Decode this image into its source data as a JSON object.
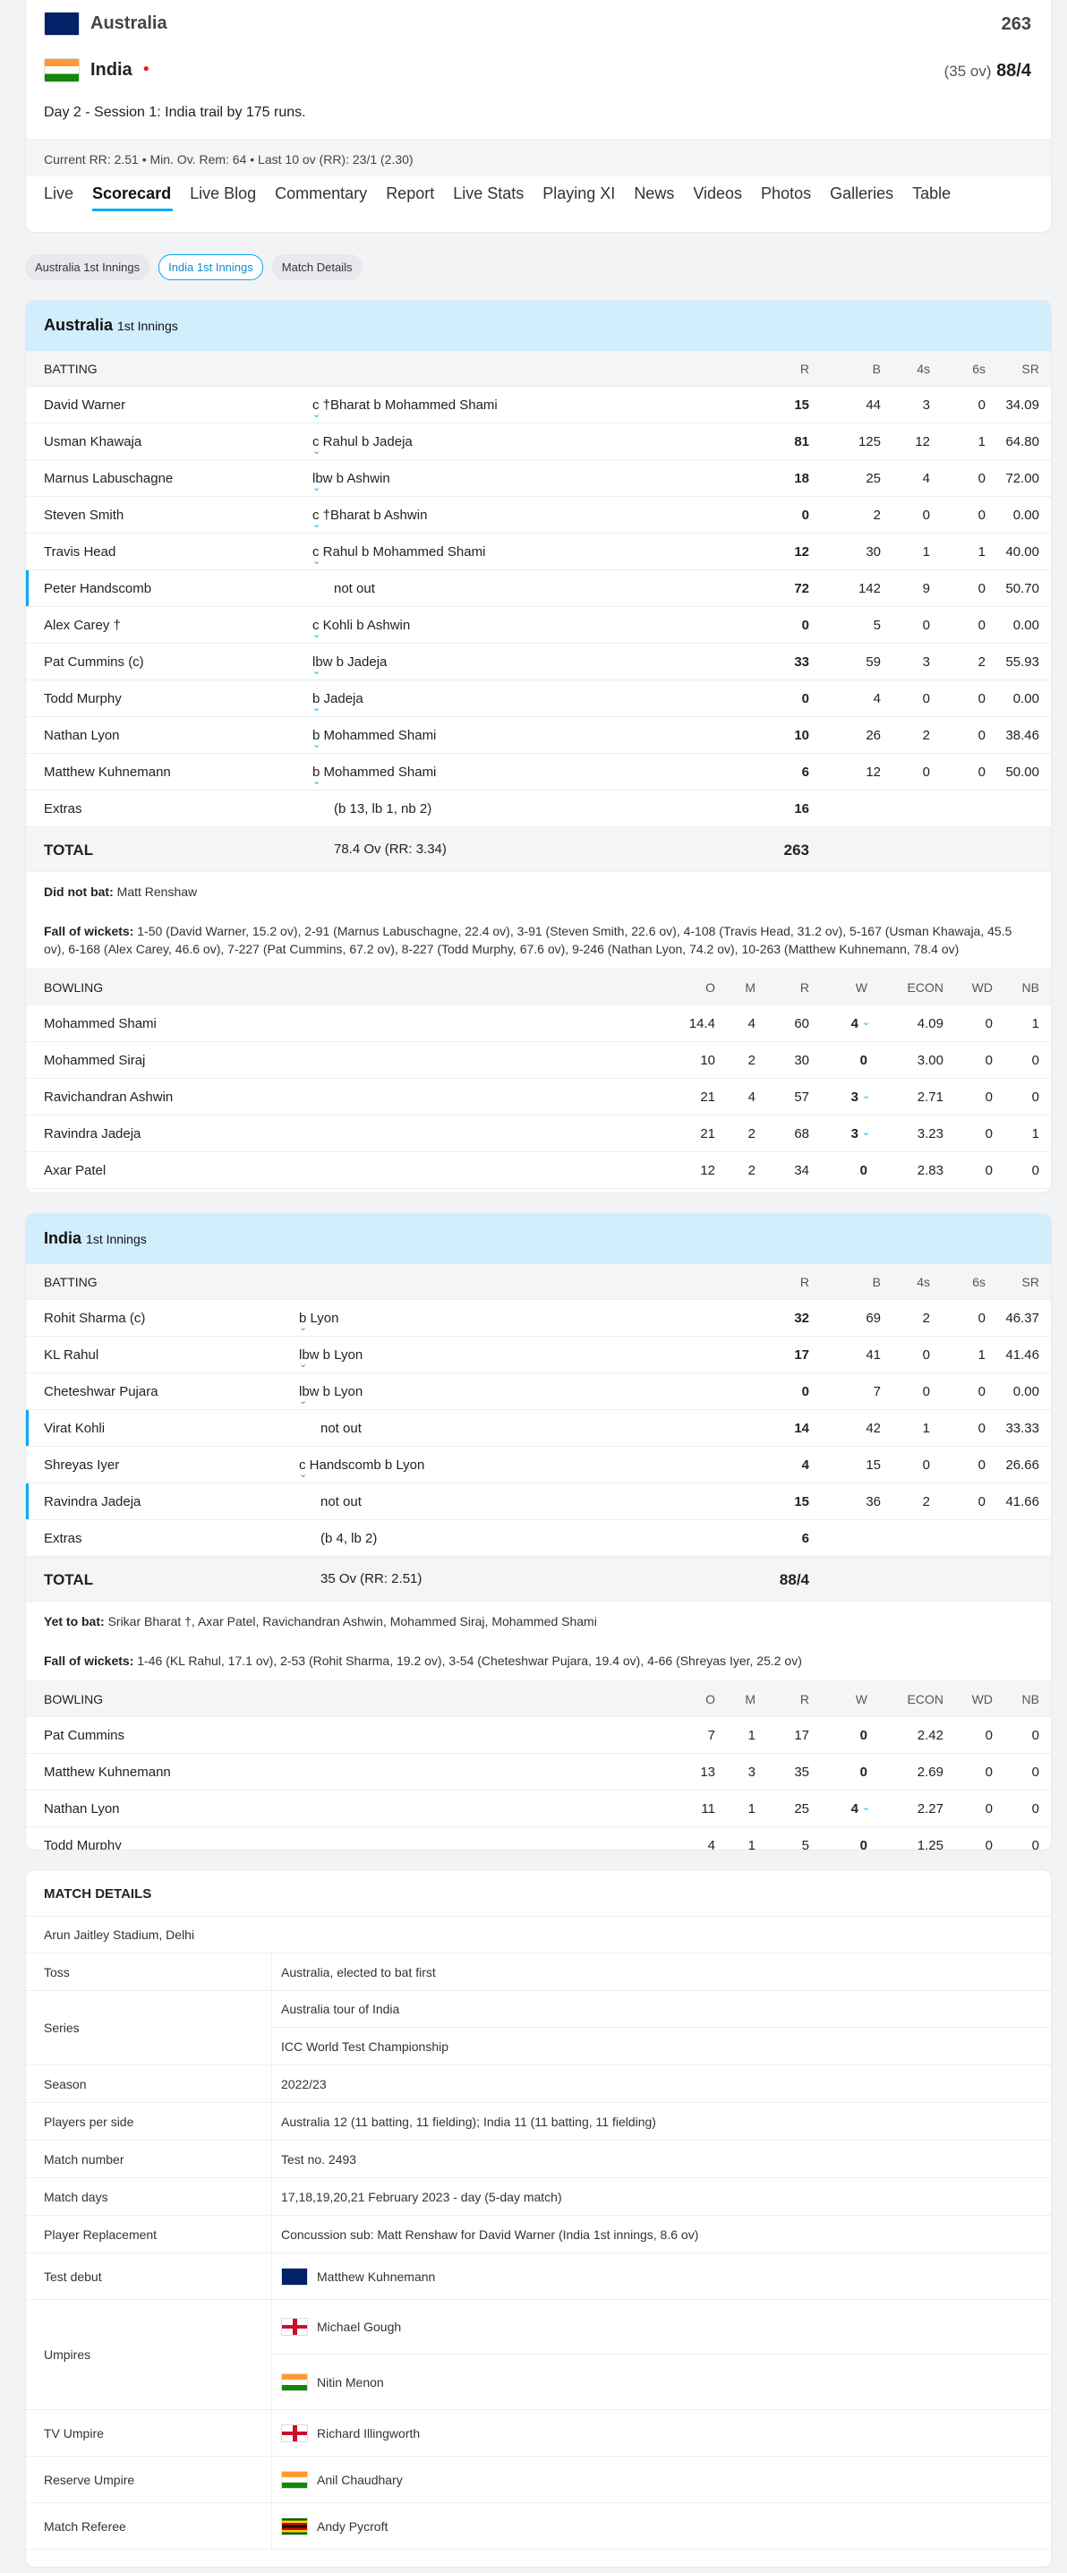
{
  "header": {
    "team1": {
      "name": "Australia",
      "score": "263"
    },
    "team2": {
      "name": "India",
      "overs": "(35 ov)",
      "score": "88/4"
    },
    "status": "Day 2 - Session 1: India trail by 175 runs.",
    "rates": "Current RR: 2.51 • Min. Ov. Rem: 64 • Last 10 ov (RR): 23/1 (2.30)",
    "tabs": [
      "Live",
      "Scorecard",
      "Live Blog",
      "Commentary",
      "Report",
      "Live Stats",
      "Playing XI",
      "News",
      "Videos",
      "Photos",
      "Galleries",
      "Table"
    ],
    "active_tab": "Scorecard"
  },
  "pills": [
    "Australia 1st Innings",
    "India 1st Innings",
    "Match Details"
  ],
  "innings1": {
    "team": "Australia",
    "label": "1st Innings",
    "bat_headers": [
      "BATTING",
      "R",
      "B",
      "4s",
      "6s",
      "SR"
    ],
    "batting": [
      [
        "David Warner",
        "c †Bharat b Mohammed Shami",
        "15",
        "44",
        "3",
        "0",
        "34.09"
      ],
      [
        "Usman Khawaja",
        "c Rahul b Jadeja",
        "81",
        "125",
        "12",
        "1",
        "64.80"
      ],
      [
        "Marnus Labuschagne",
        "lbw b Ashwin",
        "18",
        "25",
        "4",
        "0",
        "72.00"
      ],
      [
        "Steven Smith",
        "c †Bharat b Ashwin",
        "0",
        "2",
        "0",
        "0",
        "0.00"
      ],
      [
        "Travis Head",
        "c Rahul b Mohammed Shami",
        "12",
        "30",
        "1",
        "1",
        "40.00"
      ],
      [
        "Peter Handscomb",
        "not out",
        "72",
        "142",
        "9",
        "0",
        "50.70"
      ],
      [
        "Alex Carey †",
        "c Kohli b Ashwin",
        "0",
        "5",
        "0",
        "0",
        "0.00"
      ],
      [
        "Pat Cummins (c)",
        "lbw b Jadeja",
        "33",
        "59",
        "3",
        "2",
        "55.93"
      ],
      [
        "Todd Murphy",
        "b Jadeja",
        "0",
        "4",
        "0",
        "0",
        "0.00"
      ],
      [
        "Nathan Lyon",
        "b Mohammed Shami",
        "10",
        "26",
        "2",
        "0",
        "38.46"
      ],
      [
        "Matthew Kuhnemann",
        "b Mohammed Shami",
        "6",
        "12",
        "0",
        "0",
        "50.00"
      ]
    ],
    "extras": {
      "label": "Extras",
      "detail": "(b 13, lb 1, nb 2)",
      "value": "16"
    },
    "total": {
      "label": "TOTAL",
      "detail": "78.4 Ov (RR: 3.34)",
      "value": "263"
    },
    "dnb_label": "Did not bat:",
    "dnb": "Matt Renshaw",
    "fow_label": "Fall of wickets:",
    "fow": "1-50 (David Warner, 15.2 ov), 2-91 (Marnus Labuschagne, 22.4 ov), 3-91 (Steven Smith, 22.6 ov), 4-108 (Travis Head, 31.2 ov), 5-167 (Usman Khawaja, 45.5 ov), 6-168 (Alex Carey, 46.6 ov), 7-227 (Pat Cummins, 67.2 ov), 8-227 (Todd Murphy, 67.6 ov), 9-246 (Nathan Lyon, 74.2 ov), 10-263 (Matthew Kuhnemann, 78.4 ov)",
    "bowl_headers": [
      "BOWLING",
      "O",
      "M",
      "R",
      "W",
      "ECON",
      "WD",
      "NB"
    ],
    "bowling": [
      [
        "Mohammed Shami",
        "14.4",
        "4",
        "60",
        "4",
        "4.09",
        "0",
        "1"
      ],
      [
        "Mohammed Siraj",
        "10",
        "2",
        "30",
        "0",
        "3.00",
        "0",
        "0"
      ],
      [
        "Ravichandran Ashwin",
        "21",
        "4",
        "57",
        "3",
        "2.71",
        "0",
        "0"
      ],
      [
        "Ravindra Jadeja",
        "21",
        "2",
        "68",
        "3",
        "3.23",
        "0",
        "1"
      ],
      [
        "Axar Patel",
        "12",
        "2",
        "34",
        "0",
        "2.83",
        "0",
        "0"
      ]
    ]
  },
  "innings2": {
    "team": "India",
    "label": "1st Innings",
    "bat_headers": [
      "BATTING",
      "R",
      "B",
      "4s",
      "6s",
      "SR"
    ],
    "batting": [
      [
        "Rohit Sharma (c)",
        "b Lyon",
        "32",
        "69",
        "2",
        "0",
        "46.37"
      ],
      [
        "KL Rahul",
        "lbw b Lyon",
        "17",
        "41",
        "0",
        "1",
        "41.46"
      ],
      [
        "Cheteshwar Pujara",
        "lbw b Lyon",
        "0",
        "7",
        "0",
        "0",
        "0.00"
      ],
      [
        "Virat Kohli",
        "not out",
        "14",
        "42",
        "1",
        "0",
        "33.33"
      ],
      [
        "Shreyas Iyer",
        "c Handscomb b Lyon",
        "4",
        "15",
        "0",
        "0",
        "26.66"
      ],
      [
        "Ravindra Jadeja",
        "not out",
        "15",
        "36",
        "2",
        "0",
        "41.66"
      ]
    ],
    "extras": {
      "label": "Extras",
      "detail": "(b 4, lb 2)",
      "value": "6"
    },
    "total": {
      "label": "TOTAL",
      "detail": "35 Ov (RR: 2.51)",
      "value": "88/4"
    },
    "ytb_label": "Yet to bat:",
    "ytb": "Srikar Bharat †,  Axar Patel,  Ravichandran Ashwin,  Mohammed Siraj,  Mohammed Shami",
    "fow_label": "Fall of wickets:",
    "fow": "1-46 (KL Rahul, 17.1 ov), 2-53 (Rohit Sharma, 19.2 ov), 3-54 (Cheteshwar Pujara, 19.4 ov), 4-66 (Shreyas Iyer, 25.2 ov)",
    "bowl_headers": [
      "BOWLING",
      "O",
      "M",
      "R",
      "W",
      "ECON",
      "WD",
      "NB"
    ],
    "bowling": [
      [
        "Pat Cummins",
        "7",
        "1",
        "17",
        "0",
        "2.42",
        "0",
        "0"
      ],
      [
        "Matthew Kuhnemann",
        "13",
        "3",
        "35",
        "0",
        "2.69",
        "0",
        "0"
      ],
      [
        "Nathan Lyon",
        "11",
        "1",
        "25",
        "4",
        "2.27",
        "0",
        "0"
      ],
      [
        "Todd Murphy",
        "4",
        "1",
        "5",
        "0",
        "1.25",
        "0",
        "0"
      ]
    ]
  },
  "match_details": {
    "title": "MATCH DETAILS",
    "venue": "Arun Jaitley Stadium, Delhi",
    "rows": [
      {
        "label": "Toss",
        "values": [
          "Australia, elected to bat first"
        ]
      },
      {
        "label": "Series",
        "values": [
          "Australia tour of India",
          "ICC World Test Championship"
        ]
      },
      {
        "label": "Season",
        "values": [
          "2022/23"
        ]
      },
      {
        "label": "Players per side",
        "values": [
          "Australia 12 (11 batting, 11 fielding); India 11 (11 batting, 11 fielding)"
        ]
      },
      {
        "label": "Match number",
        "values": [
          "Test no. 2493"
        ]
      },
      {
        "label": "Match days",
        "values": [
          "17,18,19,20,21 February 2023 - day (5-day match)"
        ]
      },
      {
        "label": "Player Replacement",
        "values": [
          "Concussion sub: Matt Renshaw for David Warner (India 1st innings, 8.6 ov)"
        ]
      },
      {
        "label": "Test debut",
        "values": [
          "Matthew Kuhnemann"
        ],
        "flags": [
          "au"
        ]
      },
      {
        "label": "Umpires",
        "values": [
          "Michael Gough",
          "Nitin Menon"
        ],
        "flags": [
          "en",
          "in"
        ]
      },
      {
        "label": "TV Umpire",
        "values": [
          "Richard Illingworth"
        ],
        "flags": [
          "en"
        ]
      },
      {
        "label": "Reserve Umpire",
        "values": [
          "Anil Chaudhary"
        ],
        "flags": [
          "in"
        ]
      },
      {
        "label": "Match Referee",
        "values": [
          "Andy Pycroft"
        ],
        "flags": [
          "zw"
        ]
      }
    ]
  },
  "colors": {
    "accent": "#03a9f4",
    "innings_header": "#d2edfb"
  }
}
